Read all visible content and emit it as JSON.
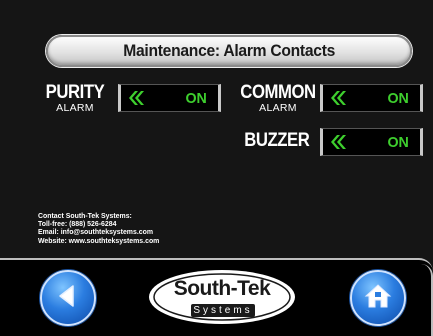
{
  "title": "Maintenance: Alarm Contacts",
  "alarms": {
    "purity": {
      "main": "PURITY",
      "sub": "ALARM",
      "state": "ON"
    },
    "common": {
      "main": "COMMON",
      "sub": "ALARM",
      "state": "ON"
    },
    "buzzer": {
      "main": "BUZZER",
      "state": "ON"
    }
  },
  "contact": {
    "line1": "Contact South-Tek Systems:",
    "line2": "Toll-free: (888) 526-6284",
    "line3": "Email: info@southteksystems.com",
    "line4": "Website: www.southteksystems.com"
  },
  "logo": {
    "line1": "South-Tek",
    "line2": "Systems"
  },
  "icons": {
    "back": "back-arrow-icon",
    "home": "home-icon",
    "toggle": "double-chevron-left-icon"
  },
  "colors": {
    "on_state": "#3ecf2e",
    "nav_button": "#2b7de0",
    "background": "#151515"
  }
}
